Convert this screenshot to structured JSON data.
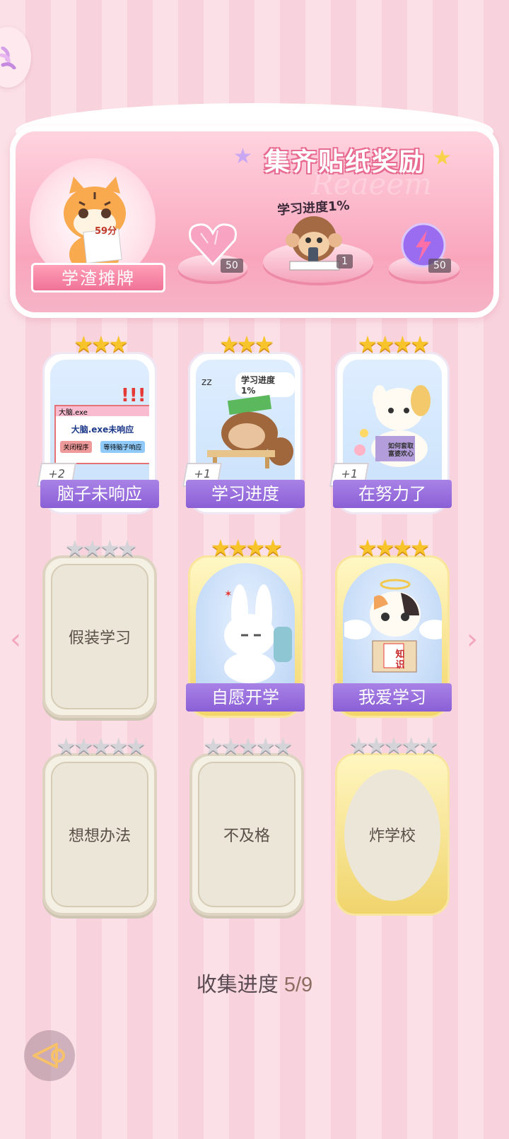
{
  "banner": {
    "title": "集齐贴纸奖励",
    "bg_word": "Reaeem",
    "mascot_label": "学渣摊牌",
    "mascot_score": "59分",
    "progress_label": "学习进度1%",
    "rewards": [
      {
        "name": "heart-gem",
        "count": "50"
      },
      {
        "name": "monkey-sticker",
        "count": "1"
      },
      {
        "name": "lightning-orb",
        "count": "50"
      }
    ]
  },
  "cards": [
    {
      "name": "脑子未响应",
      "stars": 3,
      "bonus": "+2",
      "state": "owned",
      "art_text1": "大脑.exe未响应",
      "art_btn1": "关闭程序",
      "art_btn2": "等待脑子响应",
      "art_win": "大脑.exe"
    },
    {
      "name": "学习进度",
      "stars": 3,
      "bonus": "+1",
      "state": "owned",
      "art_text1": "学习进度1%"
    },
    {
      "name": "在努力了",
      "stars": 4,
      "bonus": "+1",
      "state": "owned",
      "art_text1": "如何套取富婆欢心"
    },
    {
      "name": "假装学习",
      "stars": 4,
      "state": "locked"
    },
    {
      "name": "自愿开学",
      "stars": 4,
      "state": "gold"
    },
    {
      "name": "我爱学习",
      "stars": 4,
      "state": "gold",
      "art_text1": "知识"
    },
    {
      "name": "想想办法",
      "stars": 5,
      "state": "locked"
    },
    {
      "name": "不及格",
      "stars": 5,
      "state": "locked"
    },
    {
      "name": "炸学校",
      "stars": 5,
      "state": "gold-locked"
    }
  ],
  "footer": {
    "progress_label": "收集进度",
    "progress_value": "5/9"
  },
  "colors": {
    "accent": "#8a5fd6",
    "pink": "#f07297",
    "gold": "#f7c52b"
  }
}
